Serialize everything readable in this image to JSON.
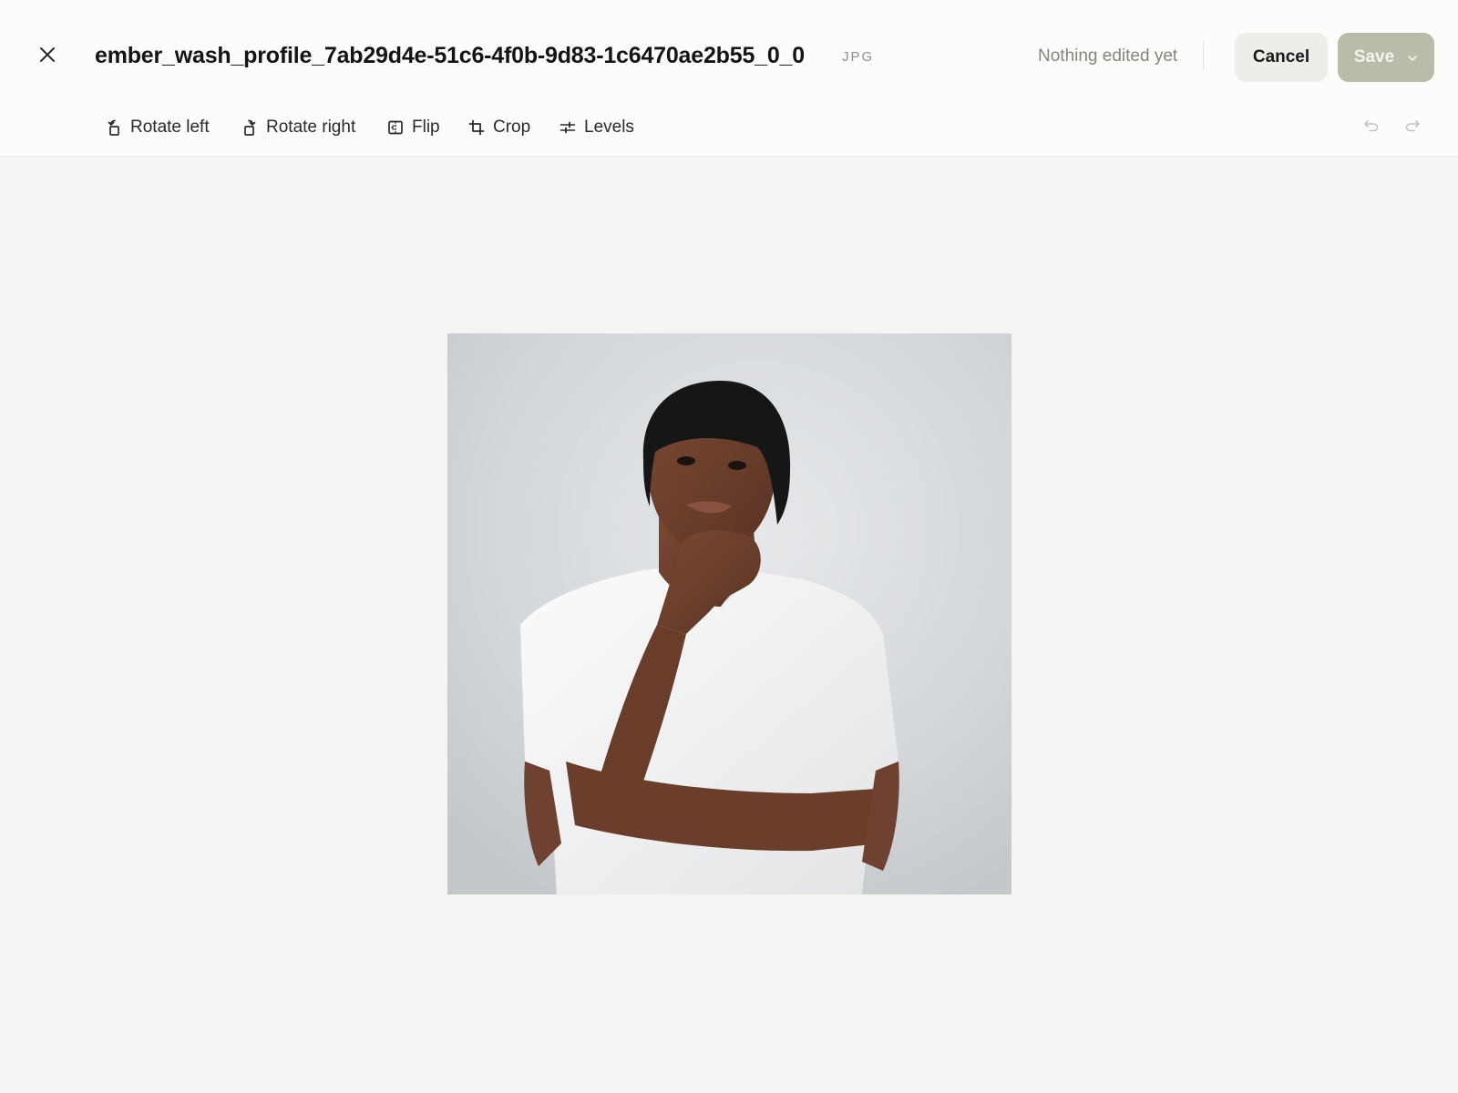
{
  "header": {
    "filename": "ember_wash_profile_7ab29d4e-51c6-4f0b-9d83-1c6470ae2b55_0_0",
    "file_type": "JPG",
    "edit_status": "Nothing edited yet",
    "cancel_label": "Cancel",
    "save_label": "Save"
  },
  "toolbar": {
    "rotate_left": "Rotate left",
    "rotate_right": "Rotate right",
    "flip": "Flip",
    "crop": "Crop",
    "levels": "Levels"
  },
  "icons": {
    "close": "close-icon",
    "rotate_left": "rotate-left-icon",
    "rotate_right": "rotate-right-icon",
    "flip": "flip-icon",
    "crop": "crop-icon",
    "levels": "sliders-icon",
    "undo": "undo-icon",
    "redo": "redo-icon",
    "save_menu": "chevron-down-icon"
  },
  "colors": {
    "save_disabled": "#b8bca8",
    "cancel_bg": "#ededea",
    "canvas_bg": "#f4f4f2"
  }
}
